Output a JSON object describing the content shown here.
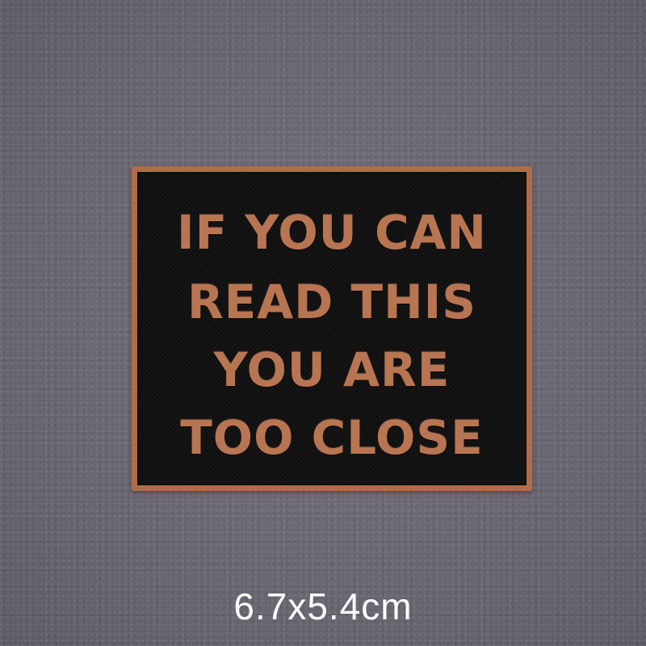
{
  "patch": {
    "lines": [
      "IF YOU CAN",
      "READ THIS",
      "YOU ARE",
      "TOO CLOSE"
    ],
    "thread_color": "#b06c48",
    "fabric_color": "#121112"
  },
  "caption": {
    "size_text": "6.7x5.4cm"
  },
  "background_color": "#6d6974"
}
